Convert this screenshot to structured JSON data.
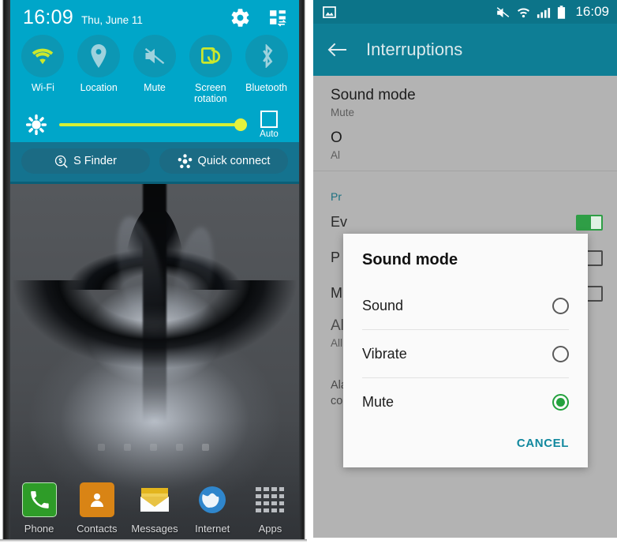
{
  "left_phone": {
    "status": {
      "time": "16:09",
      "date": "Thu, June 11"
    },
    "header_icons": [
      {
        "name": "settings-gear-icon",
        "label": "Settings"
      },
      {
        "name": "quick-settings-edit-icon",
        "label": "Edit quick settings"
      }
    ],
    "toggles": [
      {
        "label": "Wi-Fi",
        "icon": "wifi-icon",
        "active": true
      },
      {
        "label": "Location",
        "icon": "location-pin-icon",
        "active": false
      },
      {
        "label": "Mute",
        "icon": "mute-icon",
        "active": false
      },
      {
        "label": "Screen\nrotation",
        "icon": "screen-rotation-icon",
        "active": true
      },
      {
        "label": "Bluetooth",
        "icon": "bluetooth-icon",
        "active": false
      }
    ],
    "toggle_labels": [
      "Wi-Fi",
      "Location",
      "Mute",
      "Screen rotation",
      "Bluetooth"
    ],
    "toggle_label_screen_rotation_line1": "Screen",
    "toggle_label_screen_rotation_line2": "rotation",
    "brightness": {
      "icon": "brightness-sun-icon",
      "value_percent": 100,
      "auto_label": "Auto",
      "auto_checked": false
    },
    "actions": [
      {
        "label": "S Finder",
        "icon": "s-finder-icon"
      },
      {
        "label": "Quick connect",
        "icon": "quick-connect-icon"
      }
    ],
    "dock": [
      {
        "label": "Phone",
        "icon": "phone-icon",
        "color": "#2e9c28"
      },
      {
        "label": "Contacts",
        "icon": "contacts-icon",
        "color": "#d98415"
      },
      {
        "label": "Messages",
        "icon": "messages-icon",
        "color": "#e0b21a"
      },
      {
        "label": "Internet",
        "icon": "internet-globe-icon",
        "color": "#2a7fc4"
      },
      {
        "label": "Apps",
        "icon": "apps-grid-icon",
        "color": "#9aa0a6"
      }
    ],
    "page_indicator": {
      "count": 5,
      "current": 4
    },
    "accent_color": "#00a6c9",
    "highlight_color": "#d6ef33"
  },
  "right_phone": {
    "status": {
      "time": "16:09",
      "left_icon": "screenshot-image-icon",
      "right_icons": [
        "mute-icon",
        "wifi-icon",
        "signal-bars-icon",
        "battery-icon"
      ]
    },
    "appbar": {
      "back_icon": "back-arrow-icon",
      "title": "Interruptions"
    },
    "settings_rows": [
      {
        "title": "Sound mode",
        "subtitle": "Mute"
      },
      {
        "title": "O",
        "subtitle": "Al"
      }
    ],
    "section_header": "Pr",
    "options": [
      {
        "label": "Ev",
        "switch_state": "on"
      },
      {
        "label": "P",
        "switch_state": "off"
      },
      {
        "label": "M",
        "switch_state": "off"
      }
    ],
    "allowed_contacts": {
      "title": "Allowed contacts",
      "subtitle": "All"
    },
    "footnote": "Alarms and other personal reminders are always considered priority interruptions.",
    "accent_color": "#0e7e95",
    "link_color": "#1c7180"
  },
  "dialog": {
    "title": "Sound mode",
    "options": [
      {
        "label": "Sound",
        "selected": false
      },
      {
        "label": "Vibrate",
        "selected": false
      },
      {
        "label": "Mute",
        "selected": true
      }
    ],
    "cancel_label": "CANCEL",
    "selected_color": "#23a13d",
    "cancel_color": "#11889e"
  }
}
